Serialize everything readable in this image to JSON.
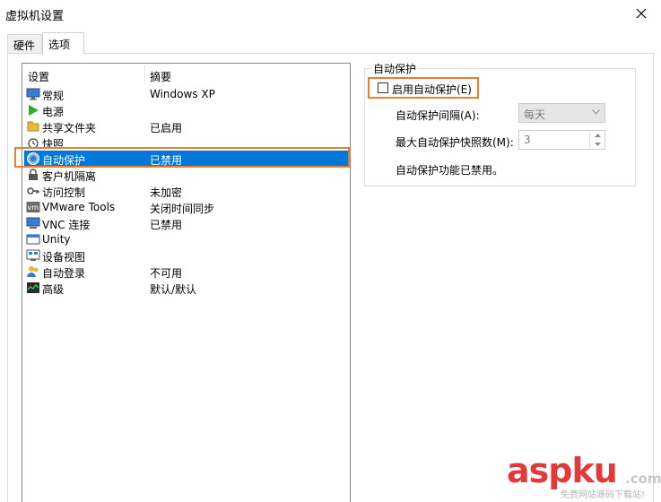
{
  "window": {
    "title": "虚拟机设置"
  },
  "tabs": [
    {
      "label": "硬件"
    },
    {
      "label": "选项"
    }
  ],
  "list": {
    "headers": {
      "setting": "设置",
      "summary": "摘要"
    },
    "rows": [
      {
        "label": "常规",
        "value": "Windows XP",
        "icon": "monitor-icon"
      },
      {
        "label": "电源",
        "value": "",
        "icon": "play-icon"
      },
      {
        "label": "共享文件夹",
        "value": "已启用",
        "icon": "folder-icon"
      },
      {
        "label": "快照",
        "value": "",
        "icon": "snapshot-icon"
      },
      {
        "label": "自动保护",
        "value": "已禁用",
        "icon": "autoprotect-icon"
      },
      {
        "label": "客户机隔离",
        "value": "",
        "icon": "lock-icon"
      },
      {
        "label": "访问控制",
        "value": "未加密",
        "icon": "key-icon"
      },
      {
        "label": "VMware Tools",
        "value": "关闭时间同步",
        "icon": "vmware-icon"
      },
      {
        "label": "VNC 连接",
        "value": "已禁用",
        "icon": "vnc-icon"
      },
      {
        "label": "Unity",
        "value": "",
        "icon": "unity-icon"
      },
      {
        "label": "设备视图",
        "value": "",
        "icon": "device-view-icon"
      },
      {
        "label": "自动登录",
        "value": "不可用",
        "icon": "users-icon"
      },
      {
        "label": "高级",
        "value": "默认/默认",
        "icon": "advanced-icon"
      }
    ],
    "selected_index": 4
  },
  "autoprotect": {
    "group_title": "自动保护",
    "enable_label": "启用自动保护(E)",
    "enabled": false,
    "interval_label": "自动保护间隔(A):",
    "interval_value": "每天",
    "max_label": "最大自动保护快照数(M):",
    "max_value": "3",
    "status": "自动保护功能已禁用。"
  },
  "watermark": {
    "brand": "aspku",
    "tld": ".com",
    "tagline": "免费网站源码下载站!"
  },
  "colors": {
    "selection": "#0078d7",
    "highlight": "#e87e2e"
  }
}
